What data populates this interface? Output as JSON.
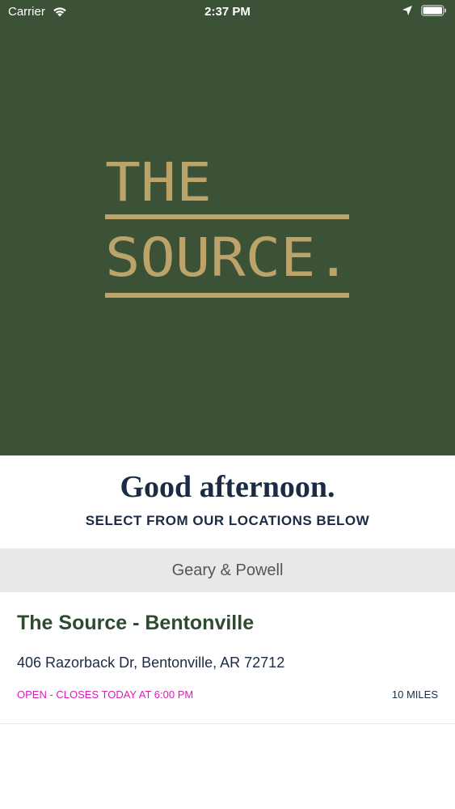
{
  "status_bar": {
    "carrier": "Carrier",
    "time": "2:37 PM",
    "icons": [
      "wifi-icon",
      "location-arrow-icon",
      "battery-icon"
    ]
  },
  "hero": {
    "background_color": "#3b5237",
    "logo": {
      "line1": "THE",
      "line2": "SOURCE.",
      "color": "#bba36a"
    }
  },
  "greeting": {
    "title": "Good afternoon.",
    "subtitle": "SELECT FROM OUR LOCATIONS BELOW"
  },
  "section": {
    "header": "Geary & Powell"
  },
  "locations": [
    {
      "name": "The Source - Bentonville",
      "address": "406 Razorback Dr, Bentonville, AR 72712",
      "hours": "OPEN - CLOSES TODAY AT 6:00 PM",
      "distance": "10 MILES"
    }
  ],
  "colors": {
    "brand_green": "#3b5237",
    "gold": "#bba36a",
    "navy": "#1b2b44",
    "open_status": "#d81fb4",
    "section_bg": "#e8e8e8"
  }
}
